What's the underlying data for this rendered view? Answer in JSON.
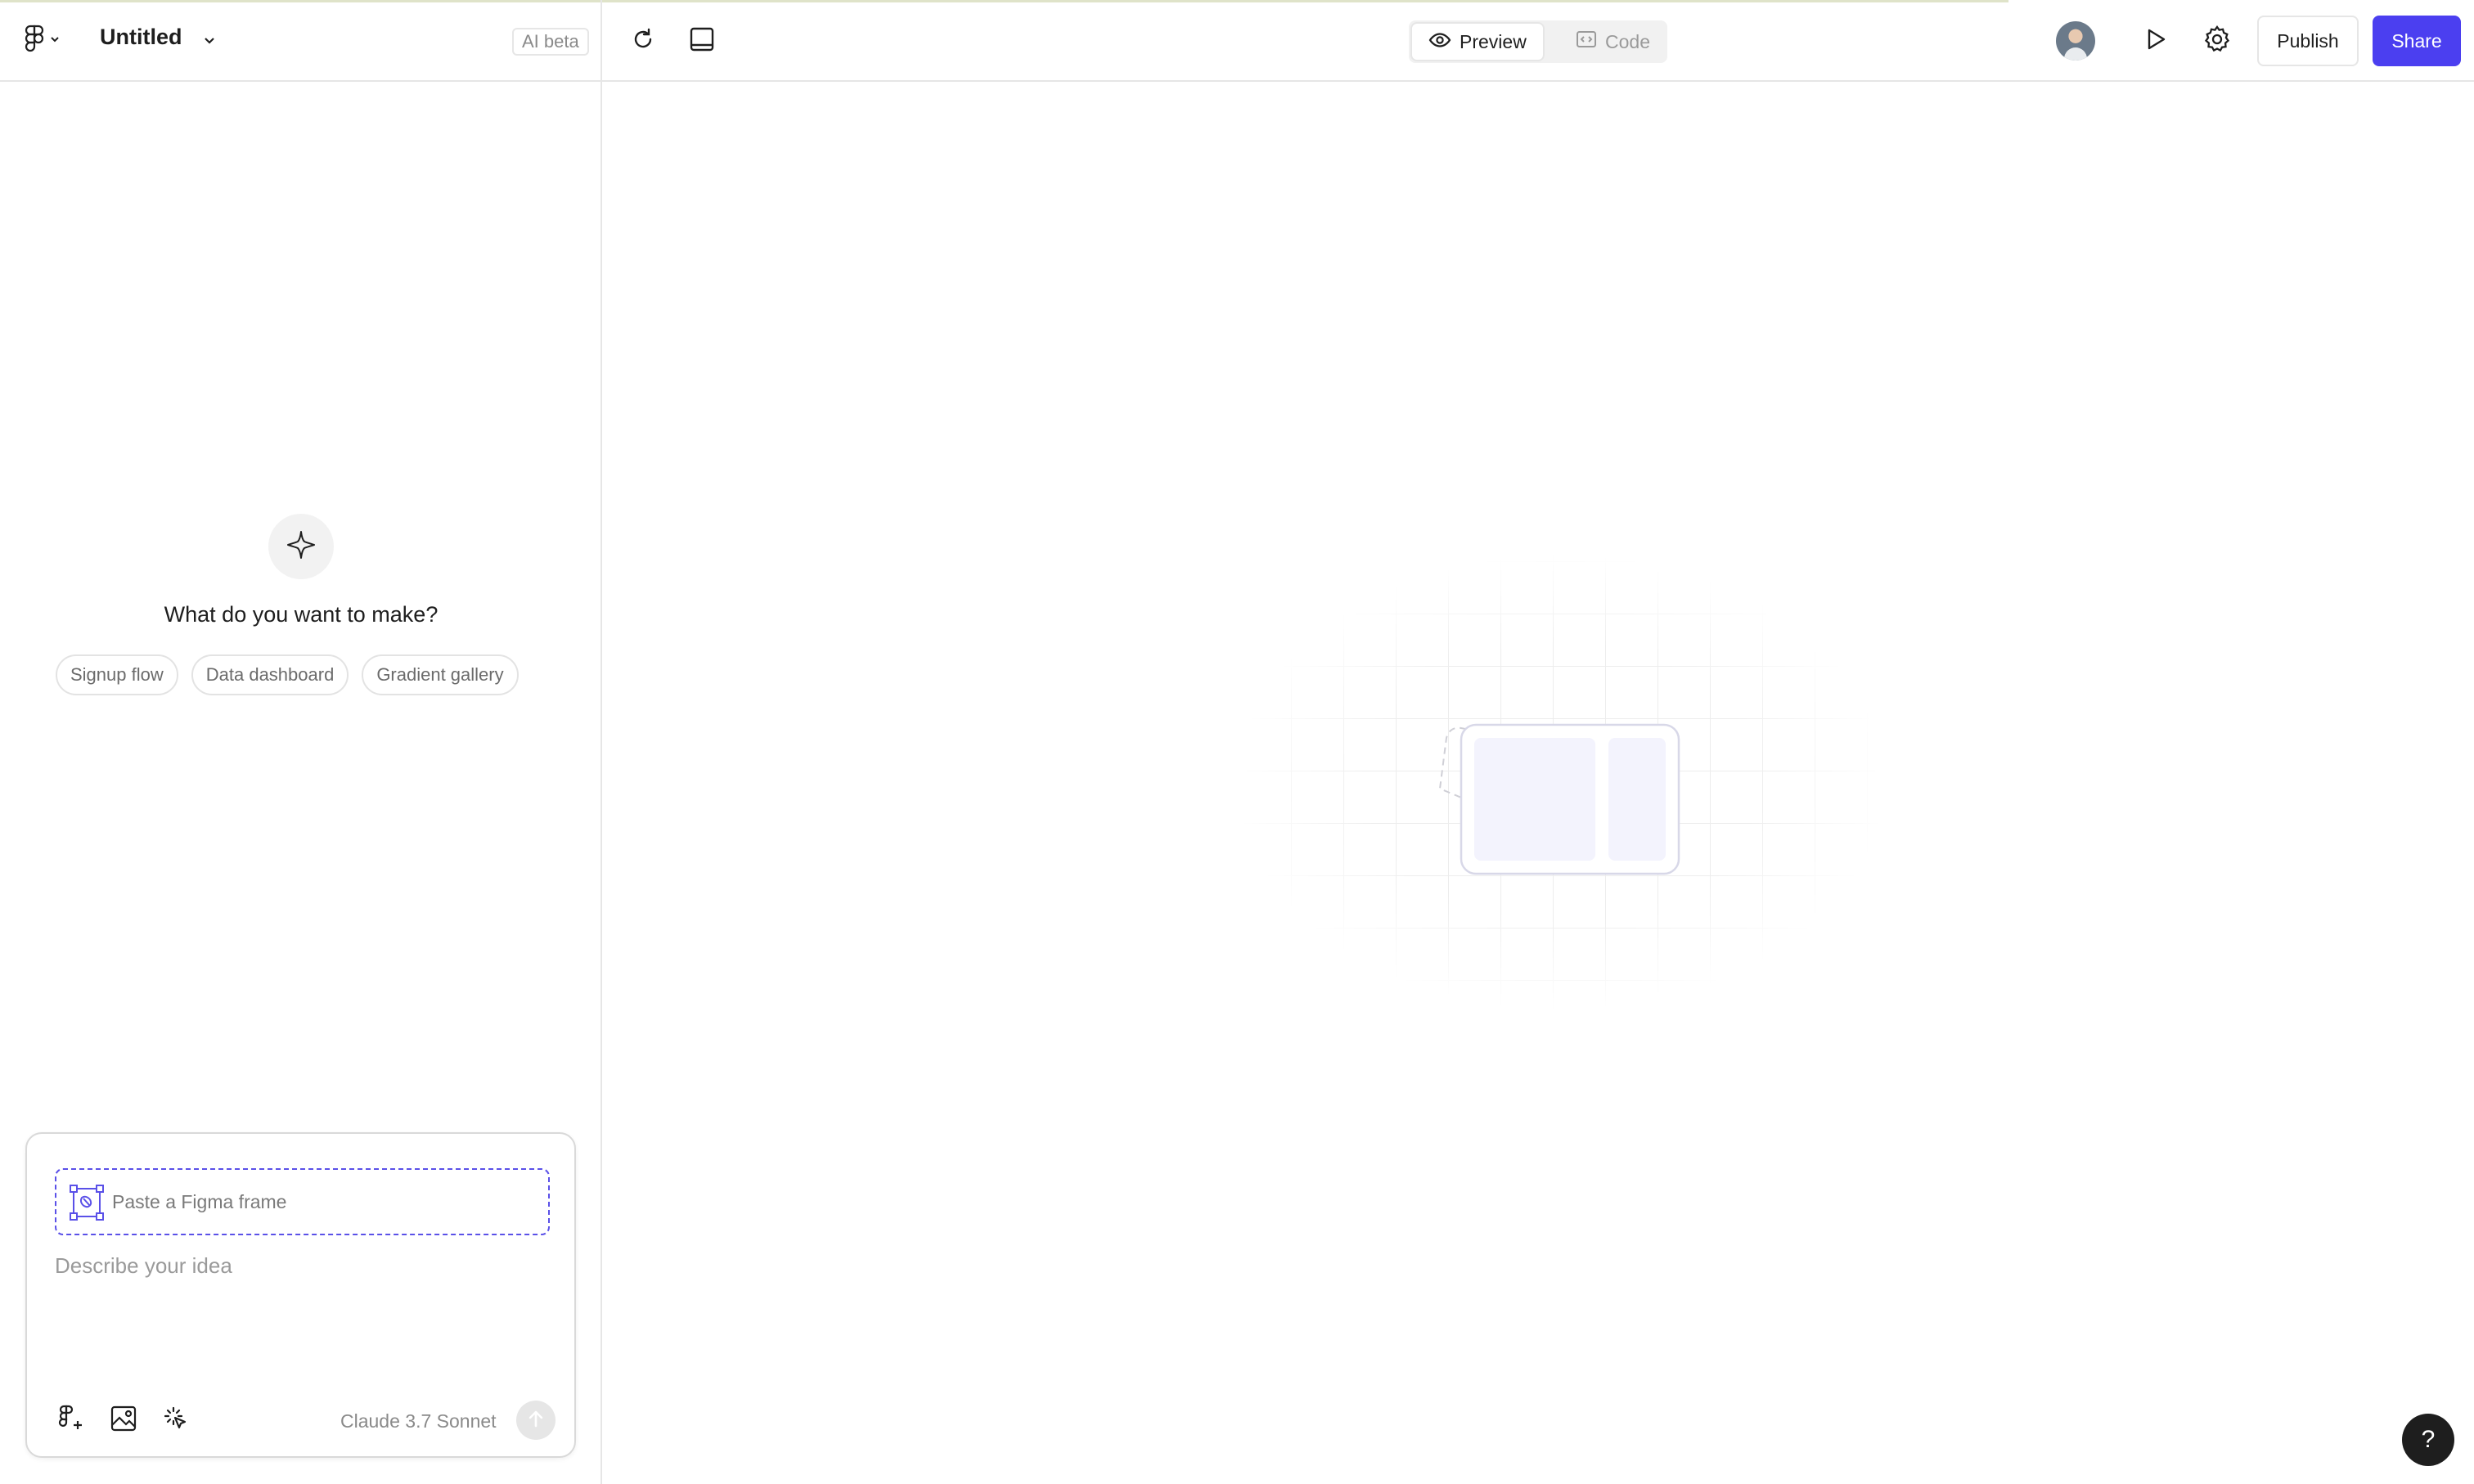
{
  "header": {
    "file_title": "Untitled",
    "ai_badge": "AI beta",
    "view_tabs": [
      {
        "label": "Preview",
        "active": true
      },
      {
        "label": "Code",
        "active": false
      }
    ],
    "publish_label": "Publish",
    "share_label": "Share"
  },
  "left_panel": {
    "heading": "What do you want to make?",
    "suggestions": [
      "Signup flow",
      "Data dashboard",
      "Gradient gallery"
    ]
  },
  "composer": {
    "paste_frame_label": "Paste a Figma frame",
    "idea_placeholder": "Describe your idea",
    "model_label": "Claude 3.7 Sonnet"
  },
  "help_label": "?",
  "colors": {
    "accent": "#4b3ff0",
    "dashed_frame": "#5a50e8"
  },
  "icons": [
    "figma-logo-icon",
    "chevron-down-icon",
    "refresh-icon",
    "panel-layout-icon",
    "eye-icon",
    "code-icon",
    "play-icon",
    "gear-icon",
    "sparkle-icon",
    "figma-frame-icon",
    "figma-add-icon",
    "image-icon",
    "select-element-icon",
    "arrow-up-icon",
    "help-icon"
  ]
}
